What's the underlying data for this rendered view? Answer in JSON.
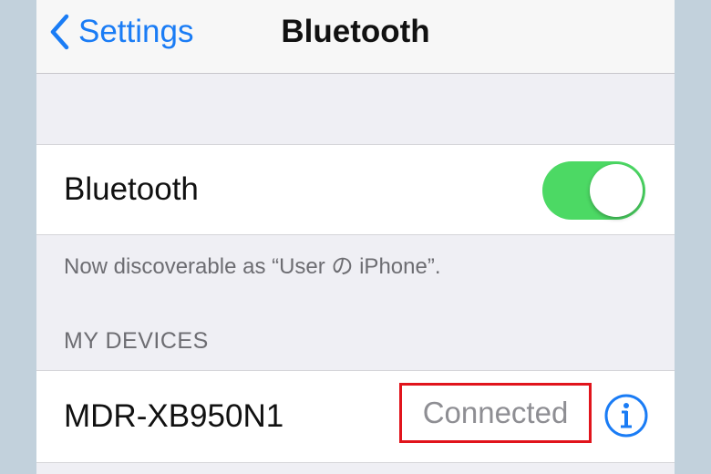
{
  "colors": {
    "accent": "#1a7cf5",
    "toggle_on": "#4cd964",
    "highlight_box": "#e1141c",
    "background": "#efeff4"
  },
  "navbar": {
    "back_icon": "chevron-left-icon",
    "back_label": "Settings",
    "title": "Bluetooth"
  },
  "bluetooth_row": {
    "label": "Bluetooth",
    "toggle_on": true
  },
  "discoverable_note": "Now discoverable as “User の iPhone”.",
  "devices_section": {
    "header": "MY DEVICES",
    "devices": [
      {
        "name": "MDR-XB950N1",
        "status": "Connected",
        "info_icon": "info-icon"
      }
    ]
  }
}
